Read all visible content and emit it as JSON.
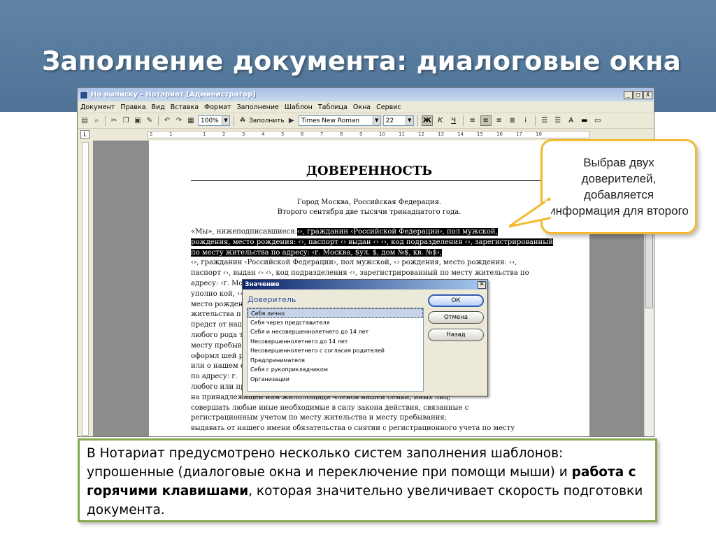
{
  "slide": {
    "title": "Заполнение документа: диалоговые окна"
  },
  "window": {
    "title": "На выписку - Нотариат [Администратор]",
    "controls": [
      "_",
      "□",
      "X"
    ]
  },
  "menu": [
    "Документ",
    "Правка",
    "Вид",
    "Вставка",
    "Формат",
    "Заполнение",
    "Шаблон",
    "Таблица",
    "Окна",
    "Сервис"
  ],
  "toolbar": {
    "zoom": "100%",
    "fill_label": "Заполнить",
    "font": "Times New Roman",
    "size": "22",
    "bold": "Ж",
    "italic": "К",
    "underline": "Ч"
  },
  "ruler": {
    "ticks": [
      "2",
      "1",
      "1",
      "2",
      "3",
      "4",
      "5",
      "6",
      "7",
      "8",
      "9",
      "10",
      "11",
      "12",
      "13",
      "14",
      "15",
      "16",
      "17",
      "18"
    ]
  },
  "document": {
    "heading": "ДОВЕРЕННОСТЬ",
    "city": "Город Москва, Российская Федерация.",
    "date": "Второго сентября две тысячи тринадцатого года.",
    "lines": [
      {
        "pre": "«Мы», нижеподписавшиеся:",
        "hl": "‹›, гражданин ‹Российской Федерации›, пол мужской,"
      },
      {
        "pre": "",
        "hl": "рождения, место рождения: ‹›, паспорт ‹› выдан ‹› ‹›, код подразделения ‹›, зарегистрированный"
      },
      {
        "pre": "",
        "hl": "по месту жительства по адресу: ‹г. Москва, $ул. $, дом №$, кв. №$›,"
      },
      {
        "pre": "‹›, гражданин ‹Российской Федерации›, пол мужской, ‹› рождения, место рождения: ‹›,",
        "hl": ""
      },
      {
        "pre": "паспорт ‹›, выдан ‹› ‹›, код подразделения ‹›, зарегистрированный по месту жительства по",
        "hl": ""
      },
      {
        "pre": "адресу: ‹г. Мо",
        "hl": ""
      },
      {
        "pre": "уполно                                                                                  кой, ‹› рождения,",
        "hl": ""
      },
      {
        "pre": "место рожден                                                                          ванного по месту",
        "hl": ""
      },
      {
        "pre": "жительства п",
        "hl": ""
      },
      {
        "pre": "предст                                                                                   от нашего имени",
        "hl": ""
      },
      {
        "pre": "любого рода                                                                            тельства либо по",
        "hl": ""
      },
      {
        "pre": "месту пребыв",
        "hl": ""
      },
      {
        "pre": "оформл                                                                                шей регистрации",
        "hl": ""
      },
      {
        "pre": "или о нашем                                                                            есту пребывания",
        "hl": ""
      },
      {
        "pre": "по адресу: г. ",
        "hl": ""
      },
      {
        "pre": "любого                                                                                 или пребывания",
        "hl": ""
      },
      {
        "pre": "на принадлежащей нам жилплощади членов нашей семьи, иных лиц;",
        "hl": ""
      },
      {
        "pre": "совершать любые иные необходимые в силу закона действия, связанные с",
        "hl": ""
      },
      {
        "pre": "регистрационным учетом по месту жительства и месту пребывания;",
        "hl": ""
      },
      {
        "pre": "выдавать от нашего имени обязательства о снятии с регистрационного учета по месту",
        "hl": ""
      }
    ]
  },
  "dialog": {
    "title": "Значение",
    "label": "Доверитель",
    "items": [
      "Себя лично",
      "Себя через представителя",
      "Себя и несовершеннолетнего до 14 лет",
      "Несовершеннолетнего до 14 лет",
      "Несовершеннолетнего с согласия родителей",
      "Предпринимателя",
      "Себя с рукоприкладчиком",
      "Организации"
    ],
    "selected_index": 0,
    "ok": "ОК",
    "cancel": "Отмена",
    "back": "Назад"
  },
  "callout": {
    "text": "Выбрав двух доверителей, добавляется информация для второго"
  },
  "note": {
    "part1": "В Нотариат предусмотрено несколько систем заполнения шаблонов: упрошенные (диалоговые окна и переключение при помощи мыши) и ",
    "bold": "работа с горячими клавишами",
    "part2": ", которая значительно увеличивает скорость подготовки документа."
  },
  "colors": {
    "header_bg": "#5a7fa2",
    "callout_border": "#f4b92f",
    "note_border": "#86a94e"
  }
}
